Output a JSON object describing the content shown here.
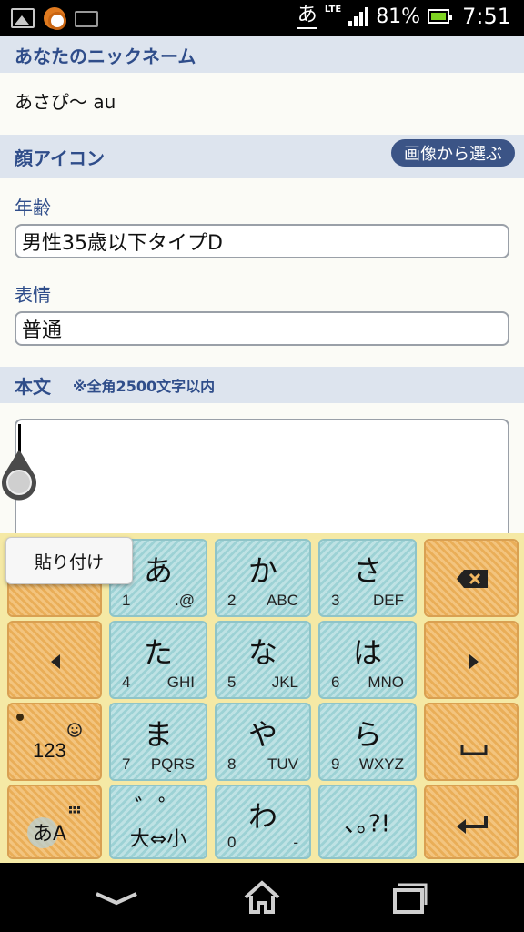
{
  "status_bar": {
    "ime_indicator": "あ",
    "network_type": "LTE",
    "battery_percent": "81%",
    "time": "7:51",
    "icons": [
      "image-icon",
      "app-circle-icon",
      "keyboard-icon",
      "signal-icon",
      "battery-icon"
    ]
  },
  "form": {
    "nickname_header": "あなたのニックネーム",
    "nickname_value": "あさぴ～ au",
    "face_icon_header": "顔アイコン",
    "choose_image_button": "画像から選ぶ",
    "age_label": "年齢",
    "age_value": "男性35歳以下タイプD",
    "expression_label": "表情",
    "expression_value": "普通",
    "body_header": "本文",
    "body_note": "※全角2500文字以内",
    "body_value": ""
  },
  "keyboard": {
    "paste_tooltip": "貼り付け",
    "keys": {
      "a": {
        "main": "あ",
        "num": "1",
        "sub": ".@"
      },
      "ka": {
        "main": "か",
        "num": "2",
        "sub": "ABC"
      },
      "sa": {
        "main": "さ",
        "num": "3",
        "sub": "DEF"
      },
      "ta": {
        "main": "た",
        "num": "4",
        "sub": "GHI"
      },
      "na": {
        "main": "な",
        "num": "5",
        "sub": "JKL"
      },
      "ha": {
        "main": "は",
        "num": "6",
        "sub": "MNO"
      },
      "ma": {
        "main": "ま",
        "num": "7",
        "sub": "PQRS"
      },
      "ya": {
        "main": "や",
        "num": "8",
        "sub": "TUV"
      },
      "ra": {
        "main": "ら",
        "num": "9",
        "sub": "WXYZ"
      },
      "daishou": {
        "main": "゛゜",
        "sub": "大⇔小"
      },
      "wa": {
        "main": "わ",
        "num": "0",
        "sub": "-"
      },
      "punct": {
        "main": "､｡?!"
      },
      "num_mode": {
        "label": "123"
      },
      "kana_mode": {
        "label": "あA"
      }
    }
  },
  "colors": {
    "header_bg": "#dde4ee",
    "header_text": "#2f4d8a",
    "button_bg": "#3b5486",
    "key_blue": "#a9d8db",
    "key_orange": "#f0b762",
    "keyboard_bg": "#f5e9a5"
  }
}
